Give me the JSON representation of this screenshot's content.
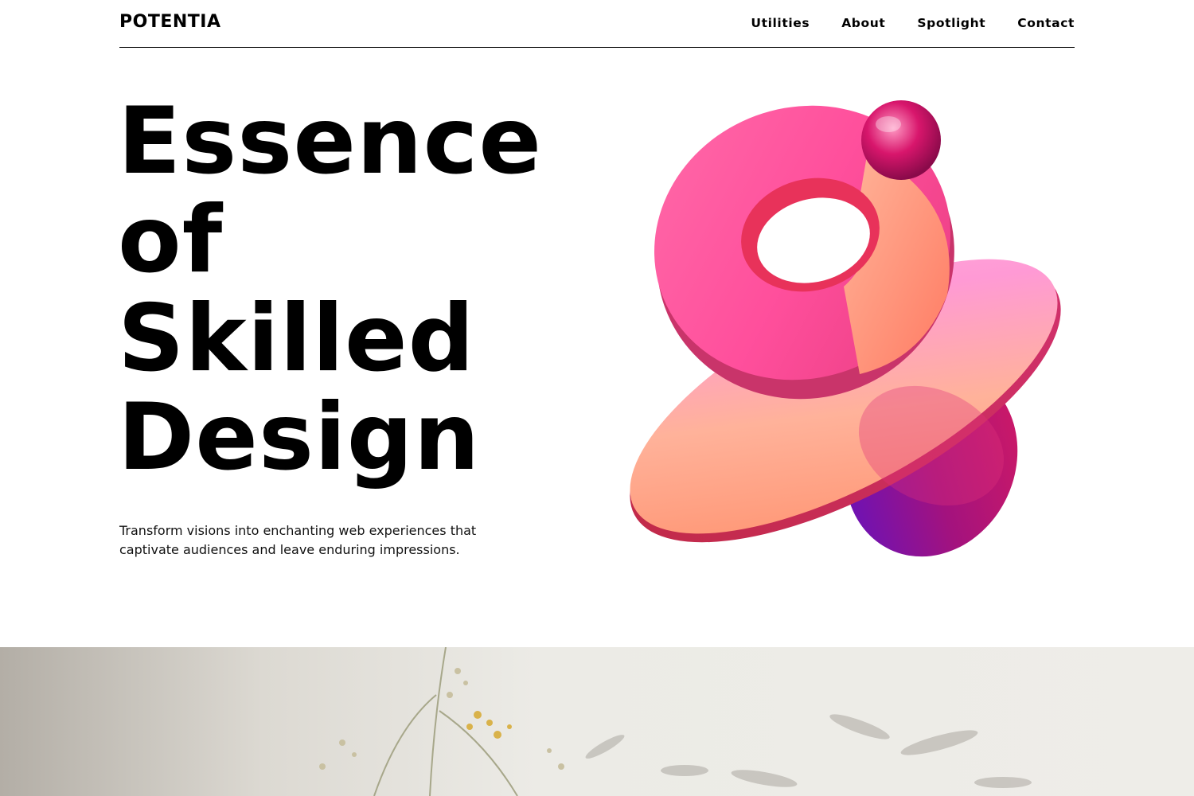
{
  "header": {
    "logo": "POTENTIA",
    "nav": [
      "Utilities",
      "About",
      "Spotlight",
      "Contact"
    ]
  },
  "hero": {
    "title_lines": [
      "Essence",
      "of",
      "Skilled",
      "Design"
    ],
    "description": "Transform visions into enchanting web experiences that captivate audiences and leave enduring impressions."
  },
  "art": {
    "name": "abstract-3d-torus-shapes",
    "colors": {
      "pink": "#ff5fa2",
      "coral": "#ff8a7a",
      "peach": "#ffb38a",
      "magenta": "#c2185b",
      "purple": "#6a0dad"
    }
  },
  "banner": {
    "name": "dried-flowers-photo",
    "background": "#ecebe6"
  }
}
